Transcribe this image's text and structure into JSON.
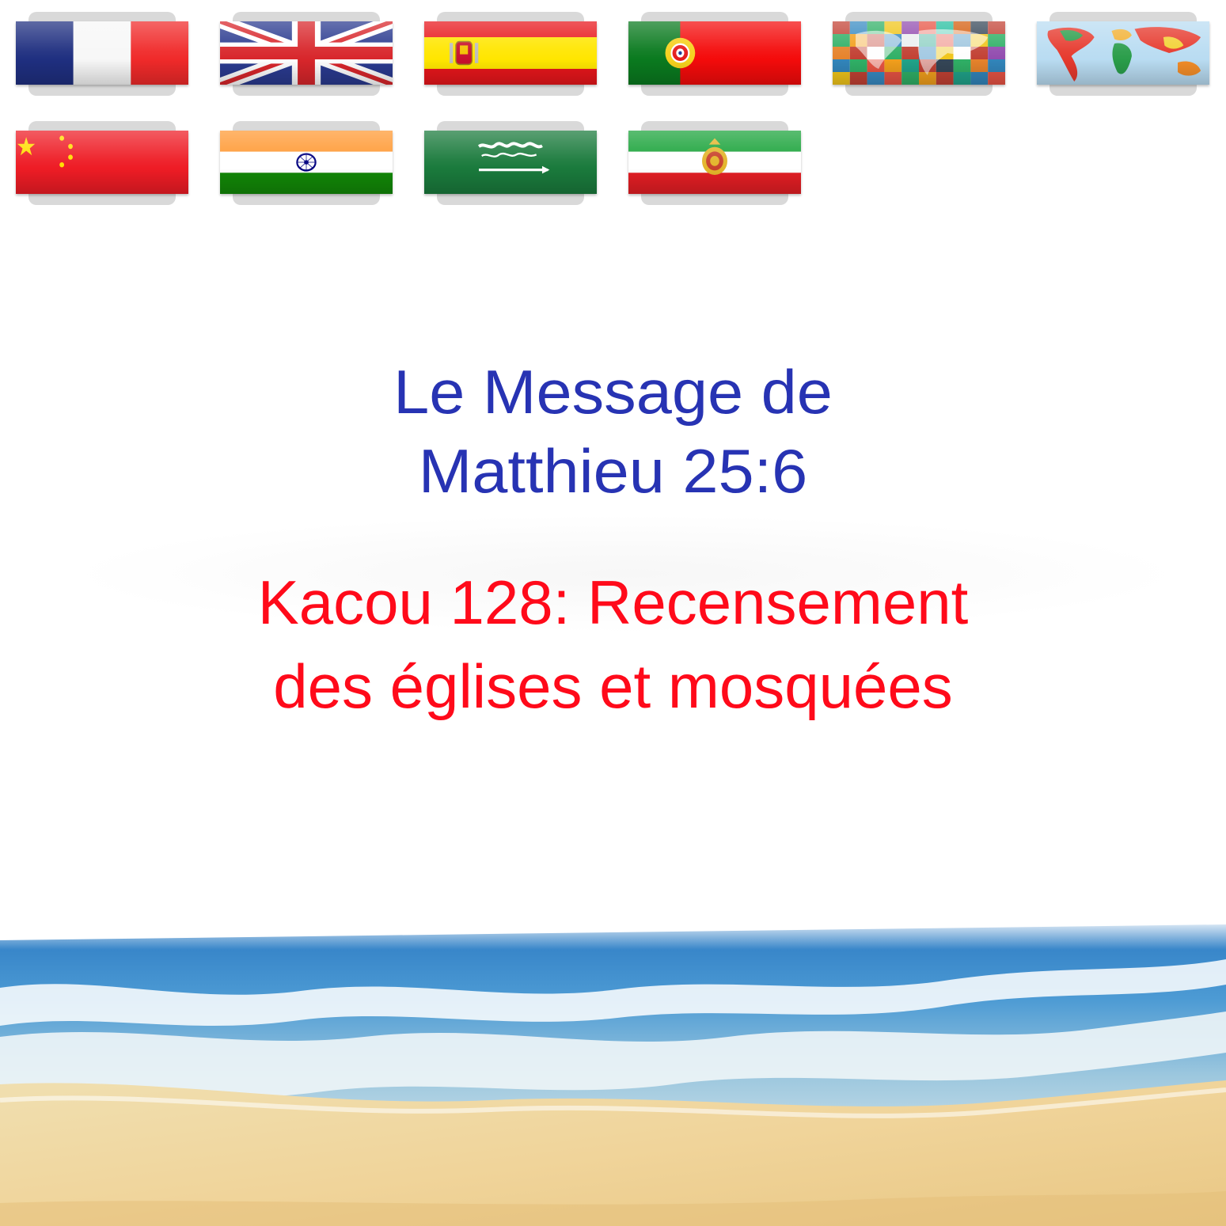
{
  "languages": [
    {
      "name": "français",
      "flag": "france-flag-icon"
    },
    {
      "name": "english",
      "flag": "united-kingdom-flag-icon"
    },
    {
      "name": "español",
      "flag": "spain-flag-icon"
    },
    {
      "name": "português",
      "flag": "portugal-flag-icon"
    },
    {
      "name": "world-flags",
      "flag": "world-flags-map-icon"
    },
    {
      "name": "world-map",
      "flag": "world-map-icon"
    },
    {
      "name": "中文",
      "flag": "china-flag-icon"
    },
    {
      "name": "india",
      "flag": "india-flag-icon"
    },
    {
      "name": "arabic",
      "flag": "saudi-arabia-flag-icon"
    },
    {
      "name": "farsi",
      "flag": "iran-flag-icon"
    }
  ],
  "heading": {
    "line1": "Le Message de",
    "line2": "Matthieu 25:6",
    "color": "#2733b3"
  },
  "subtitle": {
    "line1": "Kacou 128: Recensement",
    "line2": "des églises et mosquées",
    "color": "#ff0a1a"
  },
  "background": {
    "image": "beach-sea-waves",
    "sea_color": "#3d8fd0",
    "sand_color": "#efd8a2"
  }
}
